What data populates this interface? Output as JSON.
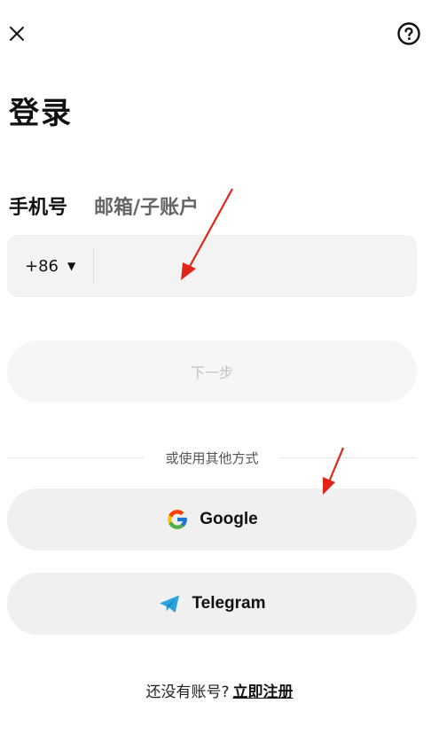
{
  "header": {
    "close_icon": "close-icon",
    "help_icon": "help-circle-icon"
  },
  "page": {
    "title": "登录"
  },
  "tabs": [
    {
      "label": "手机号",
      "active": true
    },
    {
      "label": "邮箱/子账户",
      "active": false
    }
  ],
  "phone": {
    "country_code": "+86",
    "caret_icon": "caret-down-icon",
    "value": "",
    "placeholder": ""
  },
  "next_button": {
    "label": "下一步"
  },
  "divider": {
    "text": "或使用其他方式"
  },
  "social": {
    "google_label": "Google",
    "google_icon": "google-icon",
    "telegram_label": "Telegram",
    "telegram_icon": "telegram-icon"
  },
  "signup": {
    "prompt": "还没有账号?",
    "link_label": "立即注册"
  },
  "colors": {
    "text_primary": "#111111",
    "text_secondary": "#666666",
    "field_bg": "#f3f3f3",
    "button_bg": "#f0f0f0",
    "disabled_text": "#c2c2c2",
    "annotation_arrow": "#e0261a",
    "telegram_blue": "#2aa3df"
  }
}
